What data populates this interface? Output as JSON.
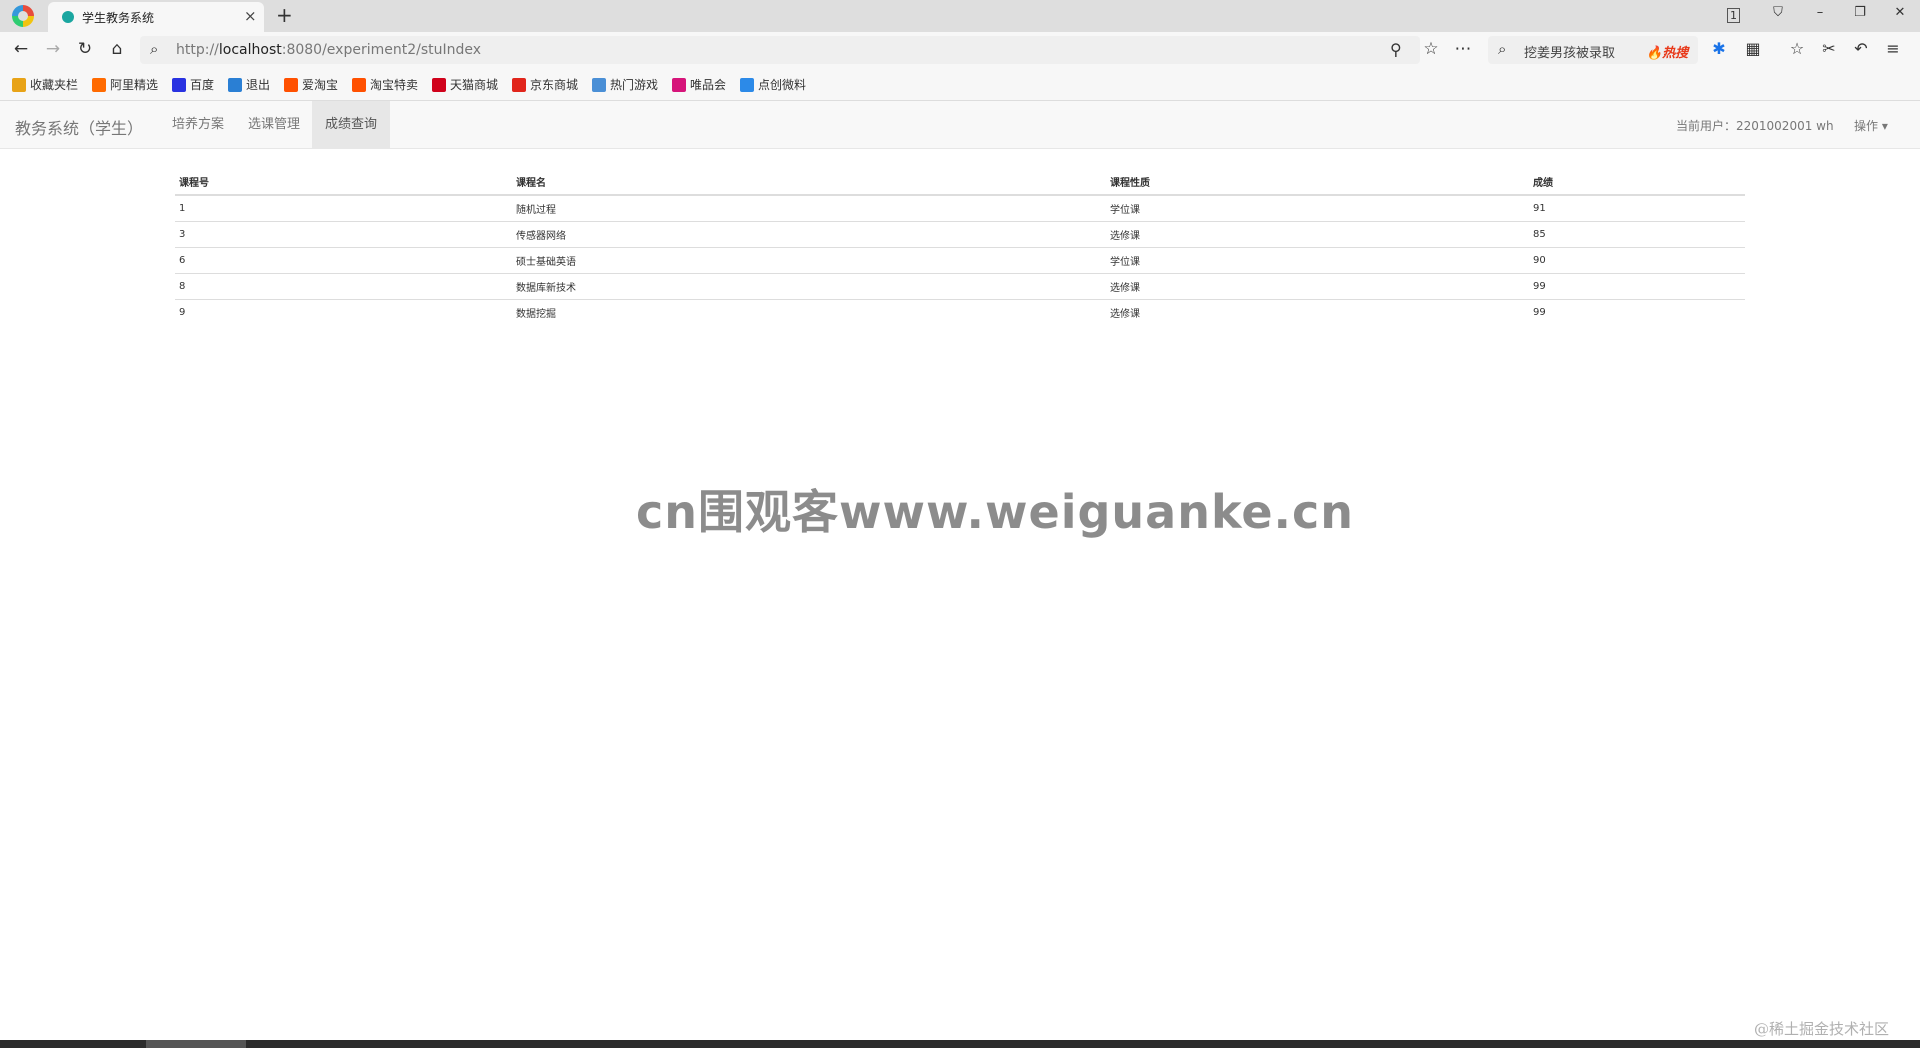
{
  "browser": {
    "tab_title": "学生教务系统",
    "tab_close": "×",
    "new_tab": "+",
    "window_controls": [
      "1",
      "⛉",
      "–",
      "❐",
      "✕"
    ],
    "address": {
      "protocol": "http://",
      "host": "localhost",
      "rest": ":8080/experiment2/stuIndex"
    },
    "search_box_text": "挖姜男孩被录取",
    "hot_label": "🔥热搜",
    "bookmarks": [
      {
        "label": "收藏夹栏",
        "color": "#e8a317"
      },
      {
        "label": "阿里精选",
        "color": "#ff6a00"
      },
      {
        "label": "百度",
        "color": "#2932e1"
      },
      {
        "label": "退出",
        "color": "#2a7fd4"
      },
      {
        "label": "爱淘宝",
        "color": "#ff5000"
      },
      {
        "label": "淘宝特卖",
        "color": "#ff5000"
      },
      {
        "label": "天猫商城",
        "color": "#d0021b"
      },
      {
        "label": "京东商城",
        "color": "#e1251b"
      },
      {
        "label": "热门游戏",
        "color": "#4a8fd6"
      },
      {
        "label": "唯品会",
        "color": "#d6147a"
      },
      {
        "label": "点创微料",
        "color": "#2c8ae8"
      }
    ]
  },
  "app": {
    "brand": "教务系统（学生）",
    "nav": [
      {
        "label": "培养方案",
        "active": false
      },
      {
        "label": "选课管理",
        "active": false
      },
      {
        "label": "成绩查询",
        "active": true
      }
    ],
    "current_user": "当前用户：2201002001 wh",
    "operation_menu": "操作 ▾"
  },
  "table": {
    "headers": [
      "课程号",
      "课程名",
      "课程性质",
      "成绩"
    ],
    "rows": [
      [
        "1",
        "随机过程",
        "学位课",
        "91"
      ],
      [
        "3",
        "传感器网络",
        "选修课",
        "85"
      ],
      [
        "6",
        "硕士基础英语",
        "学位课",
        "90"
      ],
      [
        "8",
        "数据库新技术",
        "选修课",
        "99"
      ],
      [
        "9",
        "数据挖掘",
        "选修课",
        "99"
      ]
    ]
  },
  "watermark": "cn围观客www.weiguanke.cn",
  "corner_mark": "@稀土掘金技术社区"
}
